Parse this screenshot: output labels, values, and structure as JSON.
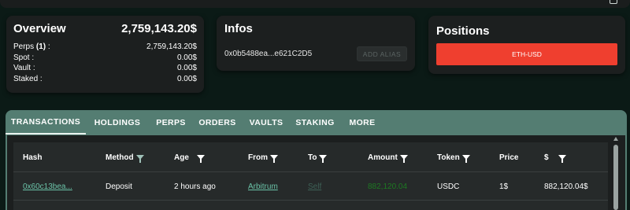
{
  "overview": {
    "title": "Overview",
    "total": "2,759,143.20$",
    "rows": [
      {
        "label": "Perps ",
        "bold": "(1)",
        "suffix": " :",
        "value": "2,759,143.20$"
      },
      {
        "label": "Spot :",
        "value": "0.00$"
      },
      {
        "label": "Vault :",
        "value": "0.00$"
      },
      {
        "label": "Staked :",
        "value": "0.00$"
      }
    ]
  },
  "infos": {
    "title": "Infos",
    "address": "0x0b5488ea...e621C2D5",
    "alias_button": "ADD ALIAS"
  },
  "positions": {
    "title": "Positions",
    "items": [
      {
        "label": "ETH-USD",
        "color": "#ef3f2f"
      }
    ]
  },
  "tabs": [
    {
      "label": "TRANSACTIONS",
      "active": true
    },
    {
      "label": "HOLDINGS"
    },
    {
      "label": "PERPS"
    },
    {
      "label": "ORDERS"
    },
    {
      "label": "VAULTS"
    },
    {
      "label": "STAKING"
    },
    {
      "label": "MORE"
    }
  ],
  "table": {
    "columns": [
      {
        "label": "Hash"
      },
      {
        "label": "Method",
        "filter": true,
        "filter_active": true
      },
      {
        "label": "Age",
        "filter": true
      },
      {
        "label": "From",
        "filter": true
      },
      {
        "label": "To",
        "filter": true
      },
      {
        "label": "Amount",
        "filter": true
      },
      {
        "label": "Token",
        "filter": true
      },
      {
        "label": "Price"
      },
      {
        "label": "$",
        "filter": true
      }
    ],
    "rows": [
      {
        "hash": "0x60c13bea...",
        "method": "Deposit",
        "age": "2 hours ago",
        "from": "Arbitrum",
        "to": "Self",
        "amount": "882,120.04",
        "token": "USDC",
        "price": "1$",
        "usd": "882,120.04$"
      }
    ]
  },
  "colors": {
    "background": "#0b1a16",
    "card": "#1c1f1f",
    "tab_bar": "#547d72",
    "accent_link": "#6bc3a8",
    "amount_positive": "#1d7a22",
    "position_short": "#ef3f2f"
  }
}
